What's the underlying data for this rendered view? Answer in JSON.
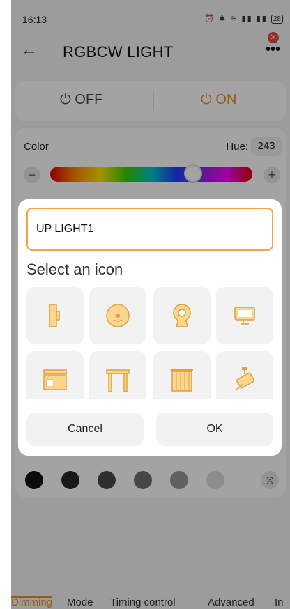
{
  "status": {
    "time": "16:13",
    "icons": "⏰ ✱ ≋ ▮▮ ▮▮",
    "battery": "28"
  },
  "appbar": {
    "back_glyph": "←",
    "title": "RGBCW LIGHT",
    "more_glyph": "•••",
    "badge_glyph": "✕"
  },
  "power": {
    "off_label": "OFF",
    "on_label": "ON",
    "icon_glyph": "⏻",
    "state": "on"
  },
  "color": {
    "label": "Color",
    "hue_label": "Hue:",
    "hue_value": "243",
    "minus": "−",
    "plus": "+"
  },
  "swatches": [
    "#111111",
    "#262626",
    "#4a4a4a",
    "#707070",
    "#969696",
    "#dcdcdc"
  ],
  "shuffle_glyph": "⤨",
  "tabs": [
    "Dimming",
    "Mode",
    "Timing control",
    "Advanced",
    "In"
  ],
  "dialog": {
    "input_value": "UP LIGHT1",
    "heading": "Select an icon",
    "icons": [
      "wall-light-icon",
      "ceiling-light-icon",
      "webcam-icon",
      "monitor-icon",
      "cabinet-icon",
      "table-icon",
      "curtain-icon",
      "spotlight-icon"
    ],
    "cancel_label": "Cancel",
    "ok_label": "OK"
  },
  "colors": {
    "accent": "#f08c1a",
    "icon_fill": "#fbd68f",
    "icon_stroke": "#e0a040"
  }
}
